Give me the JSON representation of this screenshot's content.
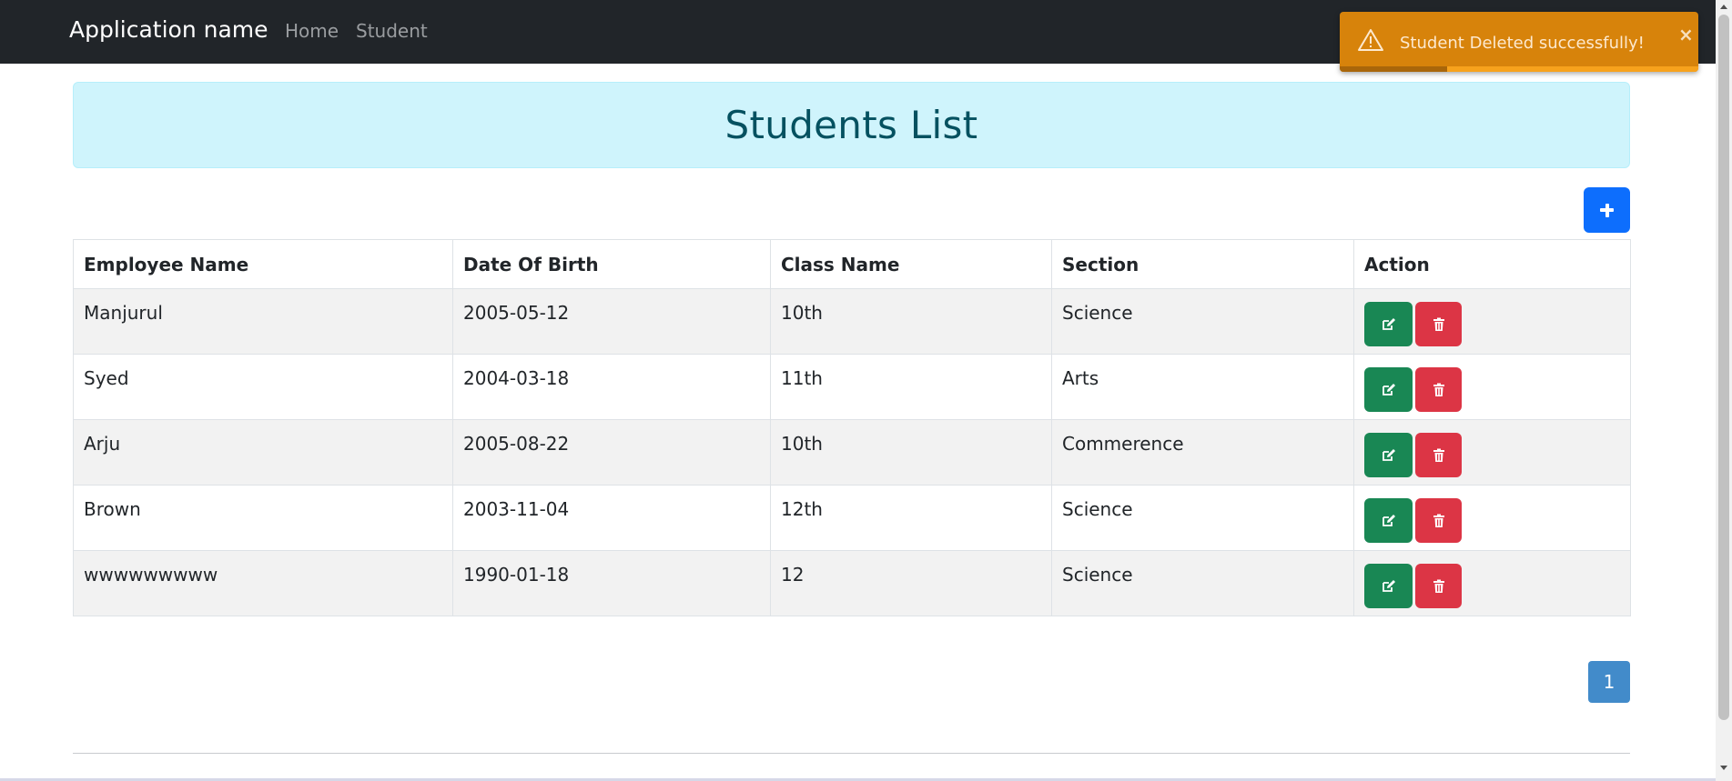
{
  "navbar": {
    "brand": "Application name",
    "links": [
      {
        "label": "Home"
      },
      {
        "label": "Student"
      }
    ]
  },
  "page": {
    "title": "Students List",
    "add_button_icon": "plus-icon"
  },
  "table": {
    "headers": [
      "Employee Name",
      "Date Of Birth",
      "Class Name",
      "Section",
      "Action"
    ],
    "rows": [
      {
        "name": "Manjurul",
        "dob": "2005-05-12",
        "class_name": "10th",
        "section": "Science"
      },
      {
        "name": "Syed",
        "dob": "2004-03-18",
        "class_name": "11th",
        "section": "Arts"
      },
      {
        "name": "Arju",
        "dob": "2005-08-22",
        "class_name": "10th",
        "section": "Commerence"
      },
      {
        "name": "Brown",
        "dob": "2003-11-04",
        "class_name": "12th",
        "section": "Science"
      },
      {
        "name": "wwwwwwwww",
        "dob": "1990-01-18",
        "class_name": "12",
        "section": "Science"
      }
    ],
    "action_icons": {
      "edit": "edit-icon",
      "delete": "trash-icon"
    }
  },
  "pagination": {
    "current_page": "1"
  },
  "toast": {
    "message": "Student Deleted successfully!",
    "icon": "warning-icon",
    "close_label": "×",
    "progress_remaining": 0.3,
    "color": "#d7830b"
  },
  "colors": {
    "navbar": "#212529",
    "title_banner": "#cff4fc",
    "title_text": "#055160",
    "primary": "#0d6efd",
    "edit": "#198754",
    "delete": "#dc3545",
    "pagination": "#428bca"
  }
}
